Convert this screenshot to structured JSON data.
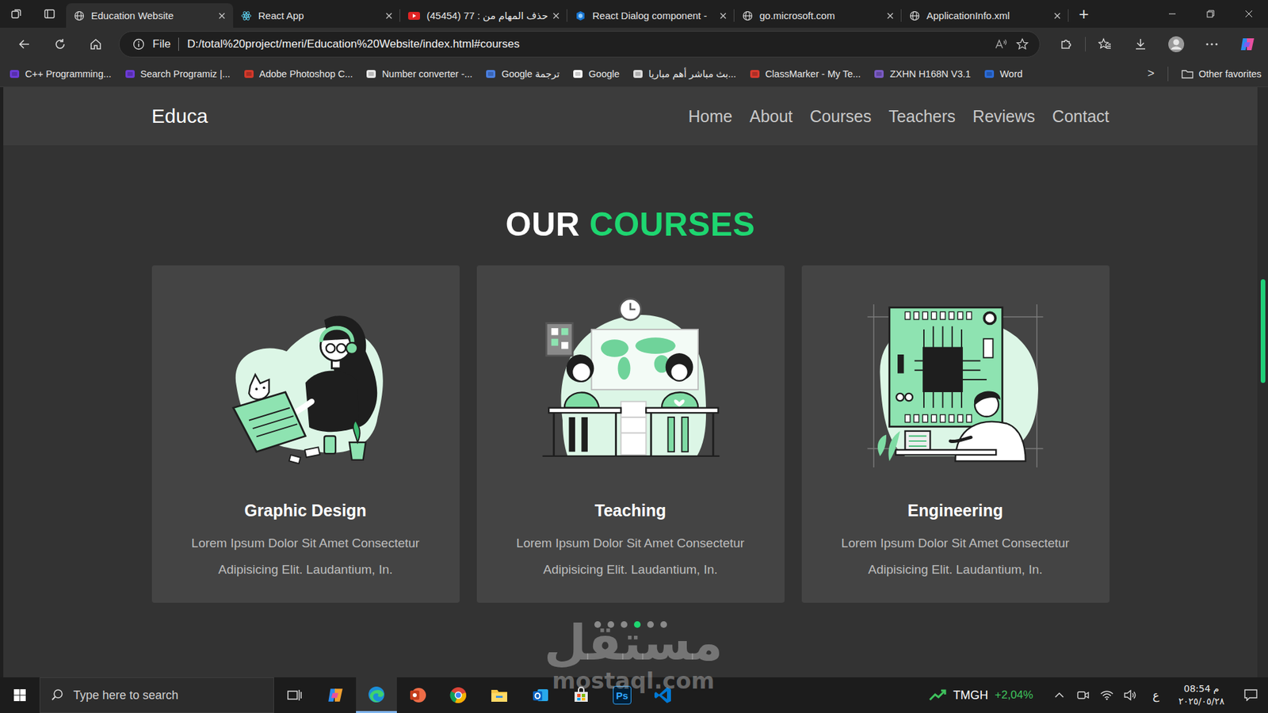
{
  "browser": {
    "tabs": [
      {
        "label": "Education Website",
        "kind": "globe",
        "selected": true
      },
      {
        "label": "React App",
        "kind": "react",
        "selected": false
      },
      {
        "label": "حذف المهام من : 77 (45454)",
        "kind": "youtube",
        "selected": false
      },
      {
        "label": "React Dialog component -",
        "kind": "dialog",
        "selected": false
      },
      {
        "label": "go.microsoft.com",
        "kind": "globe",
        "selected": false
      },
      {
        "label": "ApplicationInfo.xml",
        "kind": "globe",
        "selected": false
      }
    ],
    "new_tab": "+",
    "address": {
      "scheme": "File",
      "url": "D:/total%20project/meri/Education%20Website/index.html#courses"
    },
    "bookmarks": [
      {
        "label": "C++ Programming...",
        "kind": "programiz"
      },
      {
        "label": "Search Programiz |...",
        "kind": "programiz"
      },
      {
        "label": "Adobe Photoshop C...",
        "kind": "adobe"
      },
      {
        "label": "Number converter -...",
        "kind": "briefcase"
      },
      {
        "label": "Google ترجمة",
        "kind": "translate"
      },
      {
        "label": "Google",
        "kind": "google"
      },
      {
        "label": "بث مباشر أهم مباريا...",
        "kind": "game"
      },
      {
        "label": "ClassMarker - My Te...",
        "kind": "classmarker"
      },
      {
        "label": "ZXHN H168N V3.1",
        "kind": "zxhn"
      },
      {
        "label": "Word",
        "kind": "word"
      }
    ],
    "bookmarks_more": ">",
    "other_favorites": "Other favorites"
  },
  "page": {
    "logo": "Educa",
    "nav": [
      "Home",
      "About",
      "Courses",
      "Teachers",
      "Reviews",
      "Contact"
    ],
    "heading": {
      "first": "OUR",
      "second": "COURSES"
    },
    "courses": [
      {
        "title": "Graphic Design",
        "description": "Lorem Ipsum Dolor Sit Amet Consectetur Adipisicing Elit. Laudantium, In.",
        "kind": "design"
      },
      {
        "title": "Teaching",
        "description": "Lorem Ipsum Dolor Sit Amet Consectetur Adipisicing Elit. Laudantium, In.",
        "kind": "teaching"
      },
      {
        "title": "Engineering",
        "description": "Lorem Ipsum Dolor Sit Amet Consectetur Adipisicing Elit. Laudantium, In.",
        "kind": "engineering"
      }
    ],
    "pagination": [
      {
        "selected": false
      },
      {
        "selected": false
      },
      {
        "selected": false
      },
      {
        "selected": true
      },
      {
        "selected": false
      },
      {
        "selected": false
      }
    ]
  },
  "watermark": {
    "arabic": "مستقل",
    "latin": "mostaql.com"
  },
  "taskbar": {
    "search_placeholder": "Type here to search",
    "apps": [
      {
        "kind": "taskview",
        "label": "",
        "active": false
      },
      {
        "kind": "copilot",
        "label": "",
        "active": false
      },
      {
        "kind": "edge",
        "label": "",
        "active": true
      },
      {
        "kind": "powerpoint",
        "label": "",
        "active": false
      },
      {
        "kind": "chrome",
        "label": "",
        "active": false
      },
      {
        "kind": "explorer",
        "label": "",
        "active": false
      },
      {
        "kind": "outlook",
        "label": "",
        "active": false
      },
      {
        "kind": "store",
        "label": "",
        "active": false
      },
      {
        "kind": "photoshop",
        "label": "Ps",
        "active": false
      },
      {
        "kind": "vscode",
        "label": "",
        "active": false
      }
    ],
    "stock": {
      "symbol": "TMGH",
      "change": "+2,04%"
    },
    "language": "ع",
    "time": "08:54 م",
    "date": "٢٠٢٥/٠٥/٢٨"
  }
}
